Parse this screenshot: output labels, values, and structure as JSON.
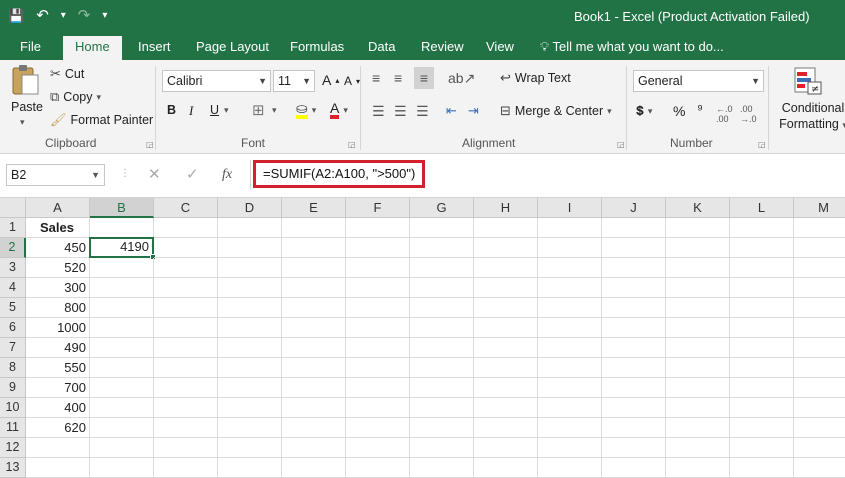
{
  "window": {
    "title": "Book1 - Excel (Product Activation Failed)"
  },
  "qat": {
    "save": "💾",
    "undo": "↶",
    "undo_menu": "▾",
    "redo": "↷",
    "customize": "▾"
  },
  "tabs": [
    "File",
    "Home",
    "Insert",
    "Page Layout",
    "Formulas",
    "Data",
    "Review",
    "View"
  ],
  "tell_me": "Tell me what you want to do...",
  "clipboard": {
    "paste": "Paste",
    "cut": "Cut",
    "copy": "Copy",
    "format_painter": "Format Painter",
    "label": "Clipboard"
  },
  "font": {
    "name": "Calibri",
    "size": "11",
    "bold": "B",
    "italic": "I",
    "underline": "U",
    "label": "Font"
  },
  "alignment": {
    "wrap_text": "Wrap Text",
    "merge_center": "Merge & Center",
    "label": "Alignment"
  },
  "number": {
    "format": "General",
    "percent": "%",
    "comma": "⁹",
    "label": "Number"
  },
  "styles": {
    "conditional_line1": "Conditional",
    "conditional_line2": "Formatting"
  },
  "formula_bar": {
    "name_box": "B2",
    "cancel": "✕",
    "enter": "✓",
    "fx": "fx",
    "formula": "=SUMIF(A2:A100, \">500\")"
  },
  "columns": [
    "A",
    "B",
    "C",
    "D",
    "E",
    "F",
    "G",
    "H",
    "I",
    "J",
    "K",
    "L",
    "M"
  ],
  "rows": [
    "1",
    "2",
    "3",
    "4",
    "5",
    "6",
    "7",
    "8",
    "9",
    "10",
    "11",
    "12",
    "13"
  ],
  "cells": {
    "A1": "Sales",
    "A2": "450",
    "A3": "520",
    "A4": "300",
    "A5": "800",
    "A6": "1000",
    "A7": "490",
    "A8": "550",
    "A9": "700",
    "A10": "400",
    "A11": "620",
    "B2": "4190"
  },
  "colors": {
    "accent": "#217346",
    "highlight_border": "#d0212d"
  }
}
